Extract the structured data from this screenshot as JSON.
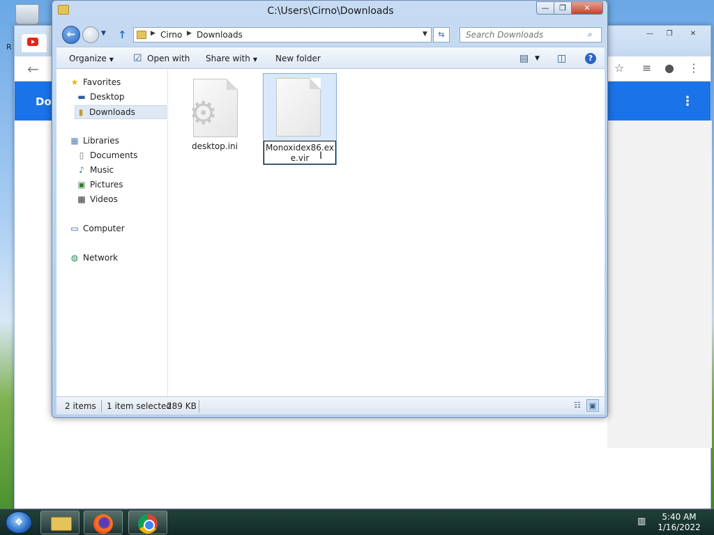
{
  "explorer": {
    "title": "C:\\Users\\Cirno\\Downloads",
    "breadcrumbs": [
      "Cirno",
      "Downloads"
    ],
    "search_placeholder": "Search Downloads",
    "commands": {
      "organize": "Organize",
      "open_with": "Open with",
      "share_with": "Share with",
      "new_folder": "New folder"
    },
    "nav": {
      "favorites": "Favorites",
      "desktop": "Desktop",
      "downloads": "Downloads",
      "libraries": "Libraries",
      "documents": "Documents",
      "music": "Music",
      "pictures": "Pictures",
      "videos": "Videos",
      "computer": "Computer",
      "network": "Network"
    },
    "files": [
      {
        "name": "desktop.ini",
        "icon": "gear-settings-file-icon"
      },
      {
        "name": "Monoxidex86.exe.vir",
        "icon": "blank-file-icon",
        "renaming": true
      }
    ],
    "status": {
      "items": "2 items",
      "selected": "1 item selected",
      "size": "289 KB"
    }
  },
  "taskbar": {
    "time": "5:40 AM",
    "date": "1/16/2022"
  },
  "background_browser": {
    "bar_text": "Do",
    "edge_letter": "R"
  },
  "colors": {
    "accent": "#1a73e8",
    "selection": "#d9e9fb"
  }
}
